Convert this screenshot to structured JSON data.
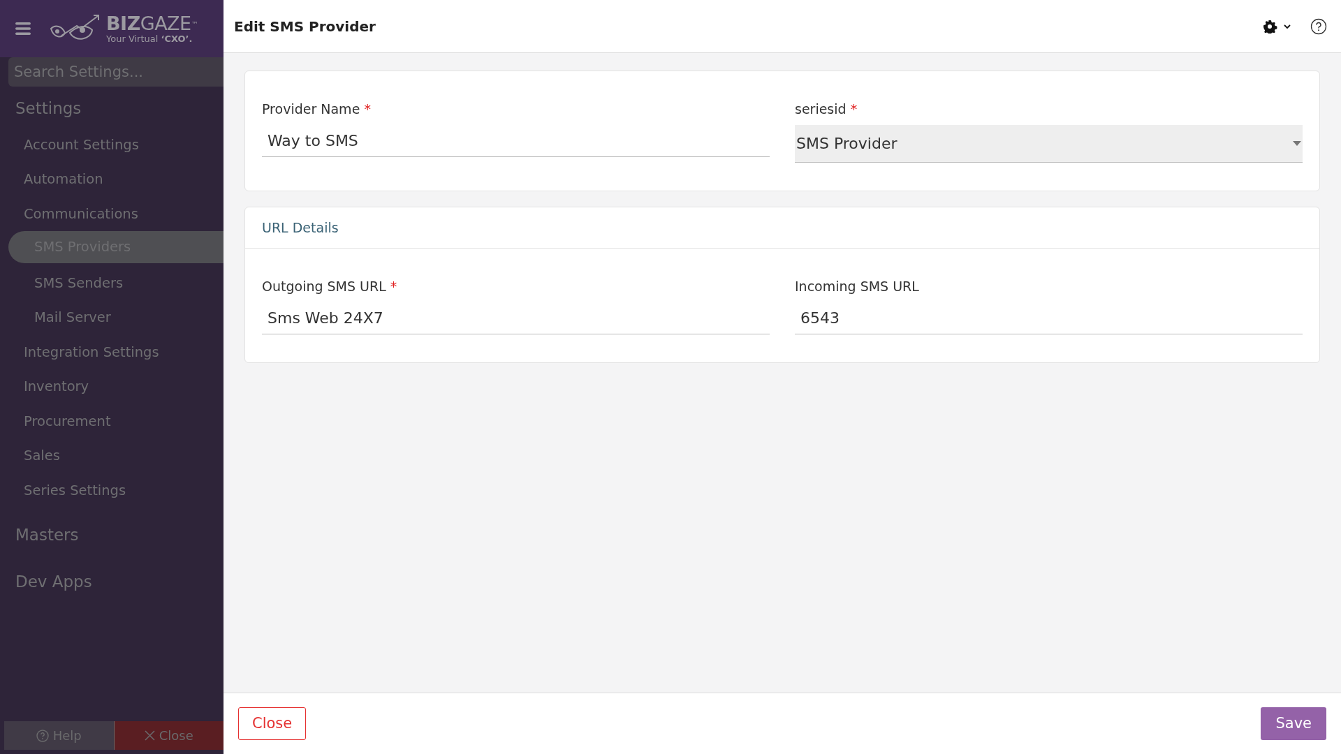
{
  "logo": {
    "brand_bold": "BIZ",
    "brand_light": "GAZE",
    "trademark": "™",
    "tagline": "Your Virtual **‘CXO’.**"
  },
  "search": {
    "placeholder": "Search Settings..."
  },
  "sidebar": {
    "sections": [
      {
        "title": "Settings",
        "items": [
          {
            "label": "Account Settings",
            "selected": false
          },
          {
            "label": "Automation",
            "selected": false
          },
          {
            "label": "Communications",
            "selected": false,
            "children": [
              {
                "label": "SMS Providers",
                "selected": true
              },
              {
                "label": "SMS Senders",
                "selected": false
              },
              {
                "label": "Mail Server",
                "selected": false
              }
            ]
          },
          {
            "label": "Integration Settings",
            "selected": false
          },
          {
            "label": "Inventory",
            "selected": false
          },
          {
            "label": "Procurement",
            "selected": false
          },
          {
            "label": "Sales",
            "selected": false
          },
          {
            "label": "Series Settings",
            "selected": false
          }
        ]
      },
      {
        "title": "Masters"
      },
      {
        "title": "Dev Apps"
      }
    ],
    "footer_buttons": [
      {
        "label": "Help",
        "kind": "help"
      },
      {
        "label": "Close",
        "kind": "close"
      }
    ]
  },
  "page_title": "Edit SMS Provider",
  "cards": [
    {
      "fields": [
        {
          "label": "Provider Name",
          "required_mark": "*",
          "kind": "text",
          "value": "Way to SMS"
        },
        {
          "label": "seriesid",
          "required_mark": "*",
          "kind": "select",
          "value": "SMS Provider"
        }
      ]
    },
    {
      "title": "URL Details",
      "fields": [
        {
          "label": "Outgoing SMS URL",
          "required_mark": "*",
          "kind": "text",
          "value": "Sms Web 24X7"
        },
        {
          "label": "Incoming SMS URL",
          "kind": "text",
          "value": "6543"
        }
      ]
    }
  ],
  "footer": {
    "buttons": [
      {
        "label": "Close",
        "kind": "secondary"
      },
      {
        "label": "Save",
        "kind": "primary"
      }
    ]
  }
}
